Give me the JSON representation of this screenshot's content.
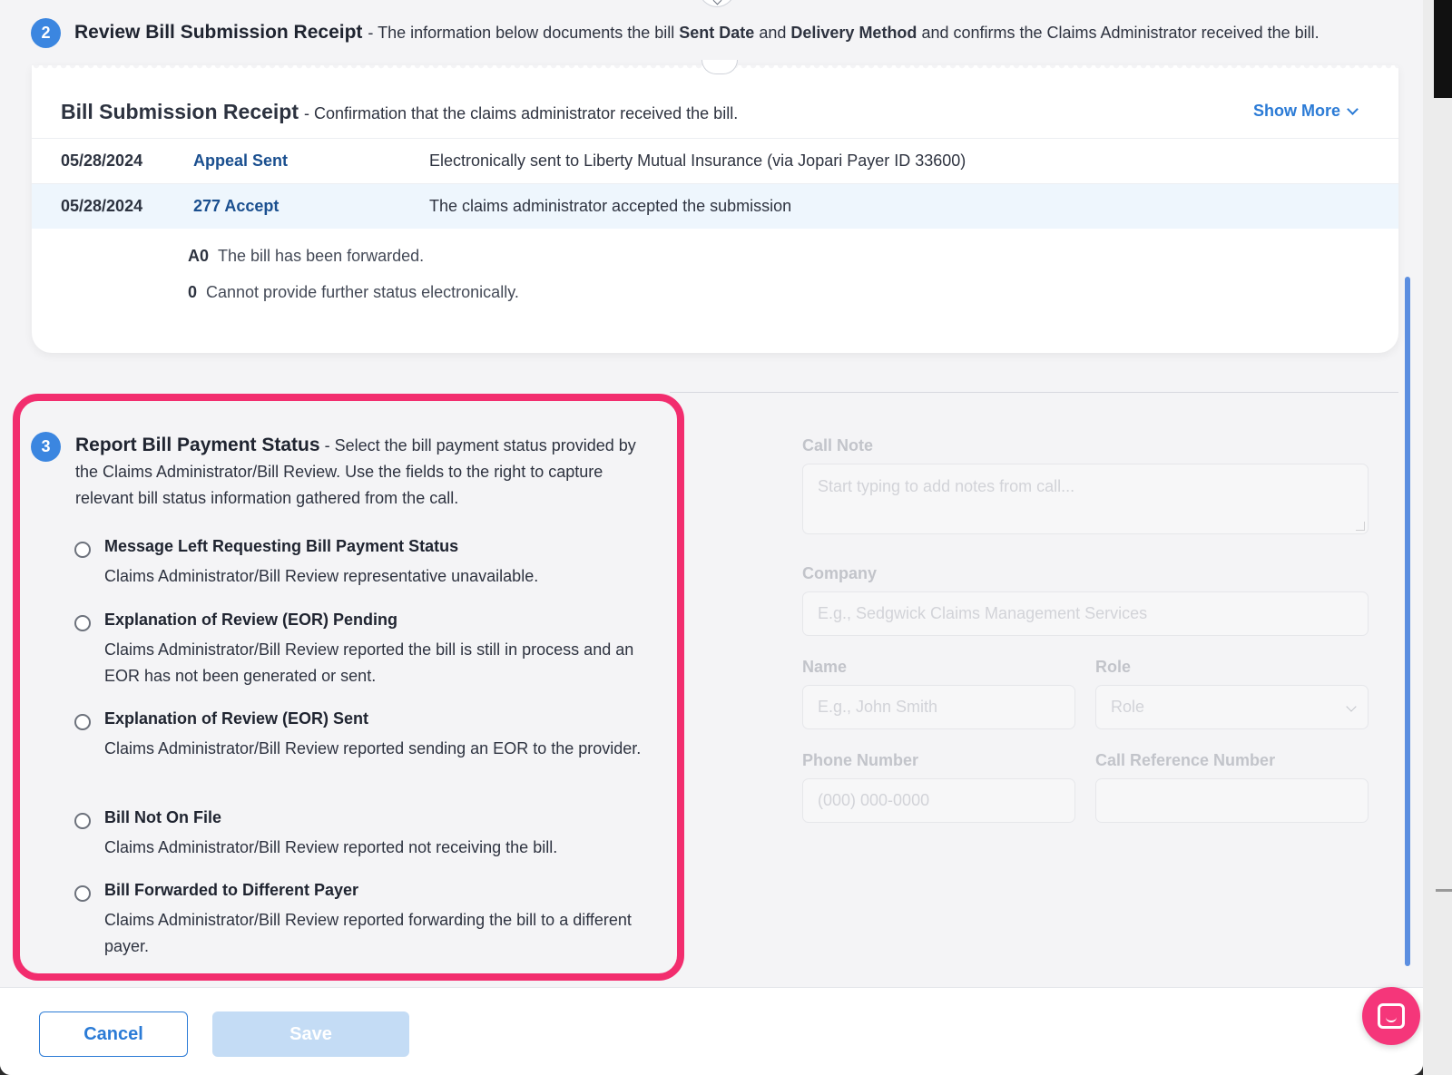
{
  "step2": {
    "number": "2",
    "title": "Review Bill Submission Receipt",
    "desc_prefix": "- The information below documents the bill",
    "bold1": "Sent Date",
    "and": "and",
    "bold2": "Delivery Method",
    "desc_suffix": "and confirms the Claims Administrator received the bill."
  },
  "receipt": {
    "title": "Bill Submission Receipt",
    "desc": "- Confirmation that the claims administrator received the bill.",
    "show_more": "Show More",
    "rows": [
      {
        "date": "05/28/2024",
        "type": "Appeal Sent",
        "info": "Electronically sent to Liberty Mutual Insurance (via Jopari Payer ID 33600)"
      },
      {
        "date": "05/28/2024",
        "type": "277 Accept",
        "info": "The claims administrator accepted the submission"
      }
    ],
    "codes": [
      {
        "code": "A0",
        "text": "The bill has been forwarded."
      },
      {
        "code": "0",
        "text": "Cannot provide further status electronically."
      }
    ]
  },
  "step3": {
    "number": "3",
    "title": "Report Bill Payment Status",
    "desc": "- Select the bill payment status provided by the Claims Administrator/Bill Review. Use the fields to the right to capture relevant bill status information gathered from the call.",
    "options": [
      {
        "title": "Message Left Requesting Bill Payment Status",
        "desc": "Claims Administrator/Bill Review representative unavailable."
      },
      {
        "title": "Explanation of Review (EOR) Pending",
        "desc": "Claims Administrator/Bill Review reported the bill is still in process and an EOR has not been generated or sent."
      },
      {
        "title": "Explanation of Review (EOR) Sent",
        "desc": "Claims Administrator/Bill Review reported sending an EOR to the provider."
      },
      {
        "title": "Bill Not On File",
        "desc": "Claims Administrator/Bill Review reported not receiving the bill."
      },
      {
        "title": "Bill Forwarded to Different Payer",
        "desc": "Claims Administrator/Bill Review reported forwarding the bill to a different payer."
      }
    ]
  },
  "form": {
    "call_note_label": "Call Note",
    "call_note_placeholder": "Start typing to add notes from call...",
    "company_label": "Company",
    "company_placeholder": "E.g., Sedgwick Claims Management Services",
    "name_label": "Name",
    "name_placeholder": "E.g., John Smith",
    "role_label": "Role",
    "role_placeholder": "Role",
    "phone_label": "Phone Number",
    "phone_placeholder": "(000) 000-0000",
    "ref_label": "Call Reference Number",
    "ref_value": ""
  },
  "footer": {
    "cancel": "Cancel",
    "save": "Save"
  },
  "icons": {
    "chat": "chat-icon",
    "chevron": "chevron-down-icon"
  },
  "colors": {
    "accent": "#2b7bd6",
    "badge": "#3b86e0",
    "highlight": "#f22d6e",
    "chat_fab": "#f5367a"
  }
}
